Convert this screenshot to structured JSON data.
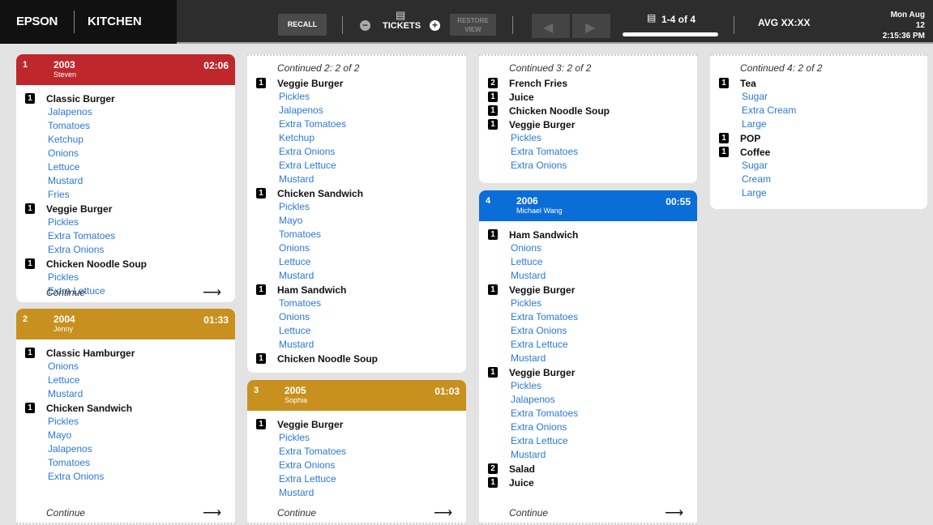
{
  "header": {
    "brand": "EPSON",
    "station": "KITCHEN",
    "recall_label": "RECALL",
    "tickets_label": "TICKETS",
    "restore_label": "RESTORE VIEW",
    "page_label": "1-4 of 4",
    "avg_label": "AVG XX:XX",
    "date": "Mon Aug 12",
    "time": "2:15:36 PM"
  },
  "colors": {
    "urgent": "#c0272d",
    "warning": "#c8911f",
    "normal": "#0a6dd8",
    "modifier": "#2b78d4"
  },
  "tickets": [
    {
      "position": "1",
      "number": "2003",
      "server": "Steven",
      "time": "02:06",
      "footer": "Continue",
      "items": [
        {
          "qty": "1",
          "name": "Classic Burger",
          "mods": [
            "Jalapenos",
            "Tomatoes",
            "Ketchup",
            "Onions",
            "Lettuce",
            "Mustard",
            "Fries"
          ]
        },
        {
          "qty": "1",
          "name": "Veggie Burger",
          "mods": [
            "Pickles",
            "Extra Tomatoes",
            "Extra Onions"
          ]
        },
        {
          "qty": "1",
          "name": "Chicken Noodle Soup",
          "mods": [
            "Pickles",
            "Extra Lettuce"
          ]
        }
      ]
    },
    {
      "position": "2",
      "number": "2004",
      "server": "Jenny",
      "time": "01:33",
      "footer": "Continue",
      "items": [
        {
          "qty": "1",
          "name": "Classic Hamburger",
          "mods": [
            "Onions",
            "Lettuce",
            "Mustard"
          ]
        },
        {
          "qty": "1",
          "name": "Chicken Sandwich",
          "mods": [
            "Pickles",
            "Mayo",
            "Jalapenos",
            "Tomatoes",
            "Extra Onions"
          ]
        }
      ]
    },
    {
      "continued": "Continued 2: 2 of 2",
      "items": [
        {
          "qty": "1",
          "name": "Veggie Burger",
          "mods": [
            "Pickles",
            "Jalapenos",
            "Extra Tomatoes",
            "Ketchup",
            "Extra Onions",
            "Extra Lettuce",
            "Mustard"
          ]
        },
        {
          "qty": "1",
          "name": "Chicken Sandwich",
          "mods": [
            "Pickles",
            "Mayo",
            "Tomatoes",
            "Onions",
            "Lettuce",
            "Mustard"
          ]
        },
        {
          "qty": "1",
          "name": "Ham Sandwich",
          "mods": [
            "Tomatoes",
            "Onions",
            "Lettuce",
            "Mustard"
          ]
        },
        {
          "qty": "1",
          "name": "Chicken Noodle Soup",
          "mods": []
        }
      ]
    },
    {
      "position": "3",
      "number": "2005",
      "server": "Sophia",
      "time": "01:03",
      "footer": "Continue",
      "items": [
        {
          "qty": "1",
          "name": "Veggie Burger",
          "mods": [
            "Pickles",
            "Extra Tomatoes",
            "Extra Onions",
            "Extra Lettuce",
            "Mustard"
          ]
        }
      ]
    },
    {
      "continued": "Continued 3: 2 of 2",
      "items": [
        {
          "qty": "2",
          "name": "French Fries",
          "mods": []
        },
        {
          "qty": "1",
          "name": "Juice",
          "mods": []
        },
        {
          "qty": "1",
          "name": "Chicken Noodle Soup",
          "mods": []
        },
        {
          "qty": "1",
          "name": "Veggie Burger",
          "mods": [
            "Pickles",
            "Extra Tomatoes",
            "Extra Onions"
          ]
        }
      ]
    },
    {
      "position": "4",
      "number": "2006",
      "server": "Michael Wang",
      "time": "00:55",
      "footer": "Continue",
      "items": [
        {
          "qty": "1",
          "name": "Ham Sandwich",
          "mods": [
            "Onions",
            "Lettuce",
            "Mustard"
          ]
        },
        {
          "qty": "1",
          "name": "Veggie Burger",
          "mods": [
            "Pickles",
            "Extra Tomatoes",
            "Extra Onions",
            "Extra Lettuce",
            "Mustard"
          ]
        },
        {
          "qty": "1",
          "name": "Veggie Burger",
          "mods": [
            "Pickles",
            "Jalapenos",
            "Extra Tomatoes",
            "Extra Onions",
            "Extra Lettuce",
            "Mustard"
          ]
        },
        {
          "qty": "2",
          "name": "Salad",
          "mods": []
        },
        {
          "qty": "1",
          "name": "Juice",
          "mods": []
        }
      ]
    },
    {
      "continued": "Continued 4: 2 of 2",
      "items": [
        {
          "qty": "1",
          "name": "Tea",
          "mods": [
            "Sugar",
            "Extra Cream",
            "Large"
          ]
        },
        {
          "qty": "1",
          "name": "POP",
          "mods": []
        },
        {
          "qty": "1",
          "name": "Coffee",
          "mods": [
            "Sugar",
            "Cream",
            "Large"
          ]
        }
      ]
    }
  ]
}
